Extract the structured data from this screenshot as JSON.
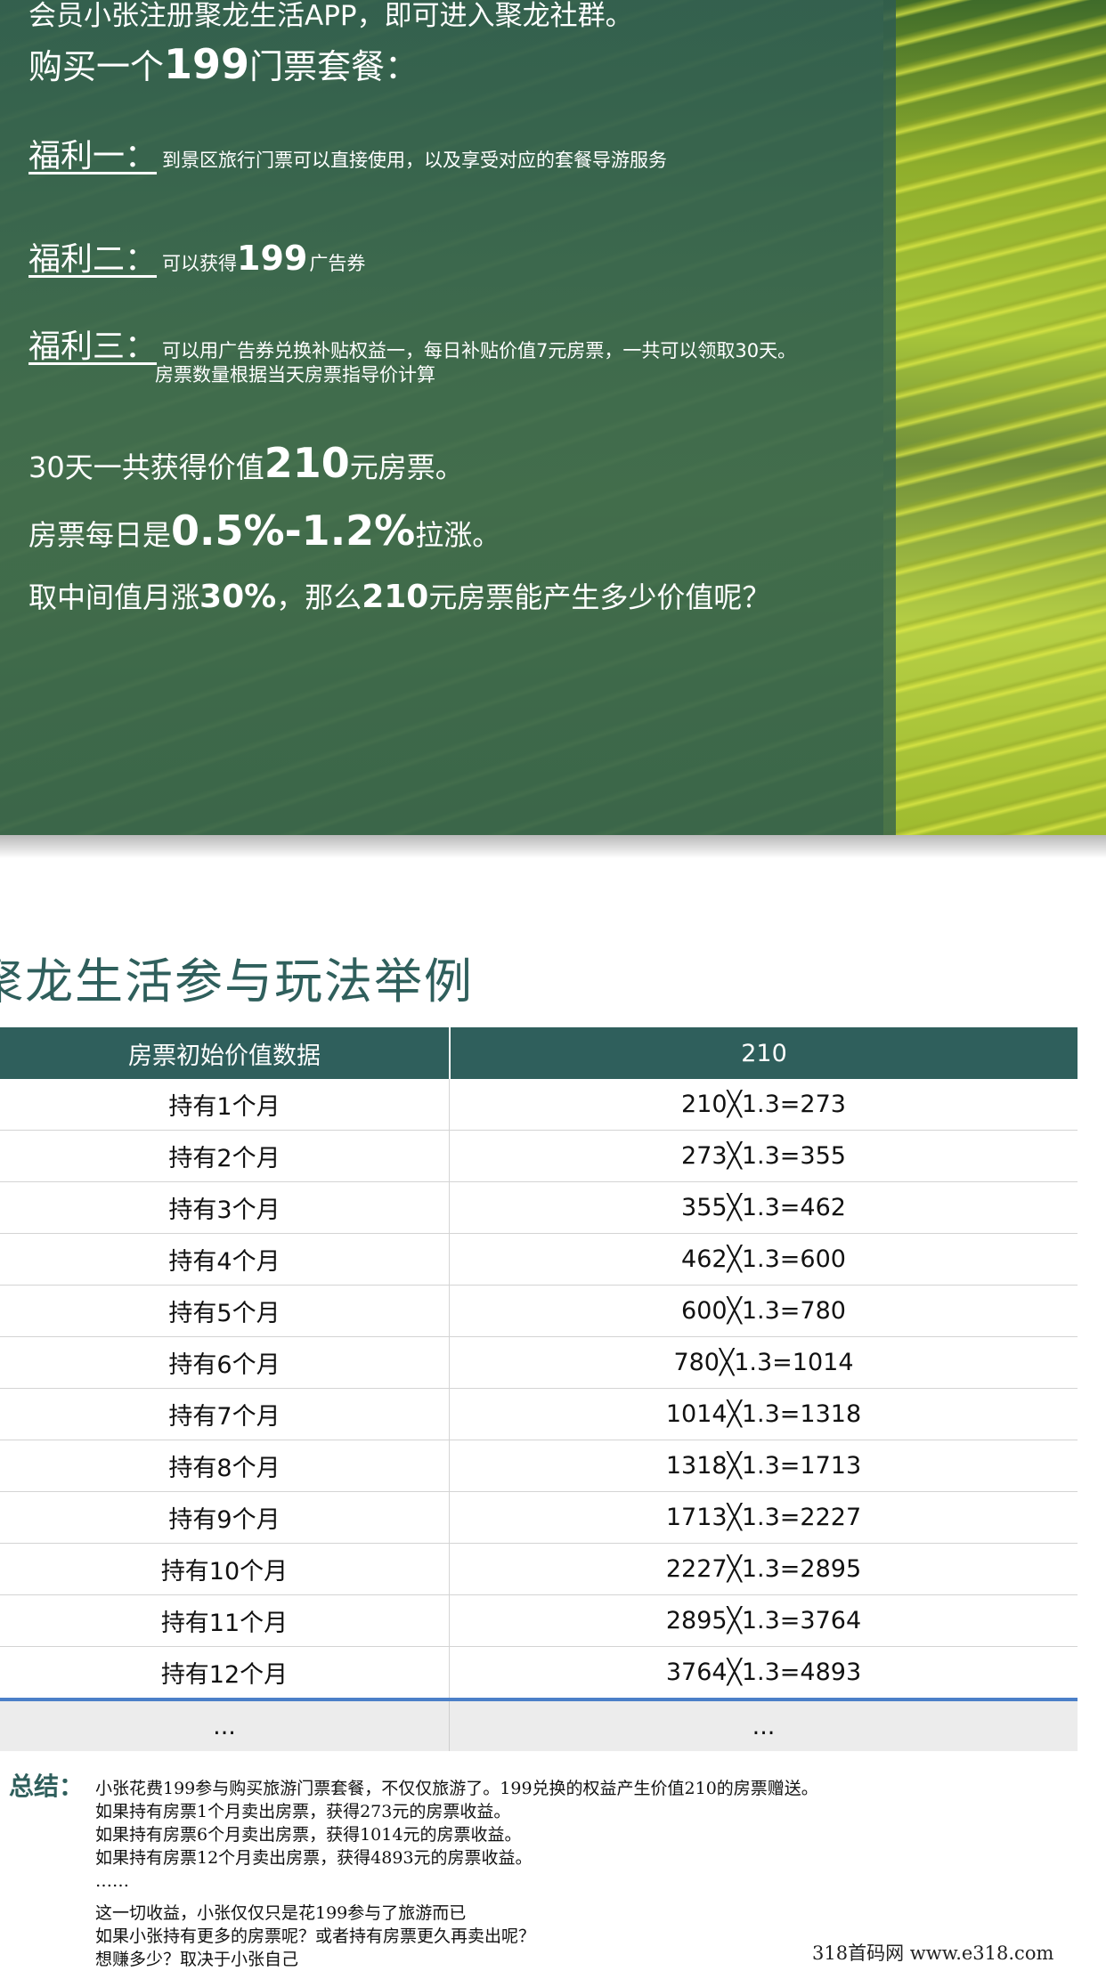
{
  "hero": {
    "line_top": "会员小张注册聚龙生活APP，即可进入聚龙社群。",
    "buy_prefix": "购买一个",
    "buy_number": "199",
    "buy_suffix": "门票套餐：",
    "benefits": [
      {
        "label": "福利一：",
        "text": "到景区旅行门票可以直接使用，以及享受对应的套餐导游服务"
      },
      {
        "label": "福利二：",
        "text_prefix": "可以获得",
        "number": "199",
        "text_suffix": "广告券"
      },
      {
        "label": "福利三：",
        "text": "可以用广告券兑换补贴权益一，每日补贴价值7元房票，一共可以领取30天。",
        "text2": "房票数量根据当天房票指导价计算"
      }
    ],
    "calc1": {
      "prefix": "30天一共获得价值",
      "number": "210",
      "suffix": "元房票。"
    },
    "calc2": {
      "prefix": "房票每日是",
      "number": "0.5%-1.2%",
      "suffix": "拉涨。"
    },
    "calc3": {
      "prefix": "取中间值月涨",
      "number": "30%",
      "middle": "，那么",
      "number2": "210",
      "suffix": "元房票能产生多少价值呢？"
    }
  },
  "section_title": "聚龙生活参与玩法举例",
  "table": {
    "header": [
      "房票初始价值数据",
      "210"
    ],
    "rows": [
      [
        "持有1个月",
        "210╳1.3=273"
      ],
      [
        "持有2个月",
        "273╳1.3=355"
      ],
      [
        "持有3个月",
        "355╳1.3=462"
      ],
      [
        "持有4个月",
        "462╳1.3=600"
      ],
      [
        "持有5个月",
        "600╳1.3=780"
      ],
      [
        "持有6个月",
        "780╳1.3=1014"
      ],
      [
        "持有7个月",
        "1014╳1.3=1318"
      ],
      [
        "持有8个月",
        "1318╳1.3=1713"
      ],
      [
        "持有9个月",
        "1713╳1.3=2227"
      ],
      [
        "持有10个月",
        "2227╳1.3=2895"
      ],
      [
        "持有11个月",
        "2895╳1.3=3764"
      ],
      [
        "持有12个月",
        "3764╳1.3=4893"
      ]
    ],
    "footer": [
      "...",
      "..."
    ]
  },
  "summary": {
    "label": "总结：",
    "lines": [
      "小张花费199参与购买旅游门票套餐，不仅仅旅游了。199兑换的权益产生价值210的房票赠送。",
      "如果持有房票1个月卖出房票，获得273元的房票收益。",
      "如果持有房票6个月卖出房票，获得1014元的房票收益。",
      "如果持有房票12个月卖出房票，获得4893元的房票收益。",
      "……"
    ],
    "lines2": [
      "这一切收益，小张仅仅只是花199参与了旅游而已",
      "如果小张持有更多的房票呢？或者持有房票更久再卖出呢？",
      "想赚多少？取决于小张自己"
    ]
  },
  "watermark": "318首码网  www.e318.com",
  "colors": {
    "primary": "#2f5f5c",
    "footer_rule": "#4a7fc8",
    "footer_bg": "#ececec"
  }
}
